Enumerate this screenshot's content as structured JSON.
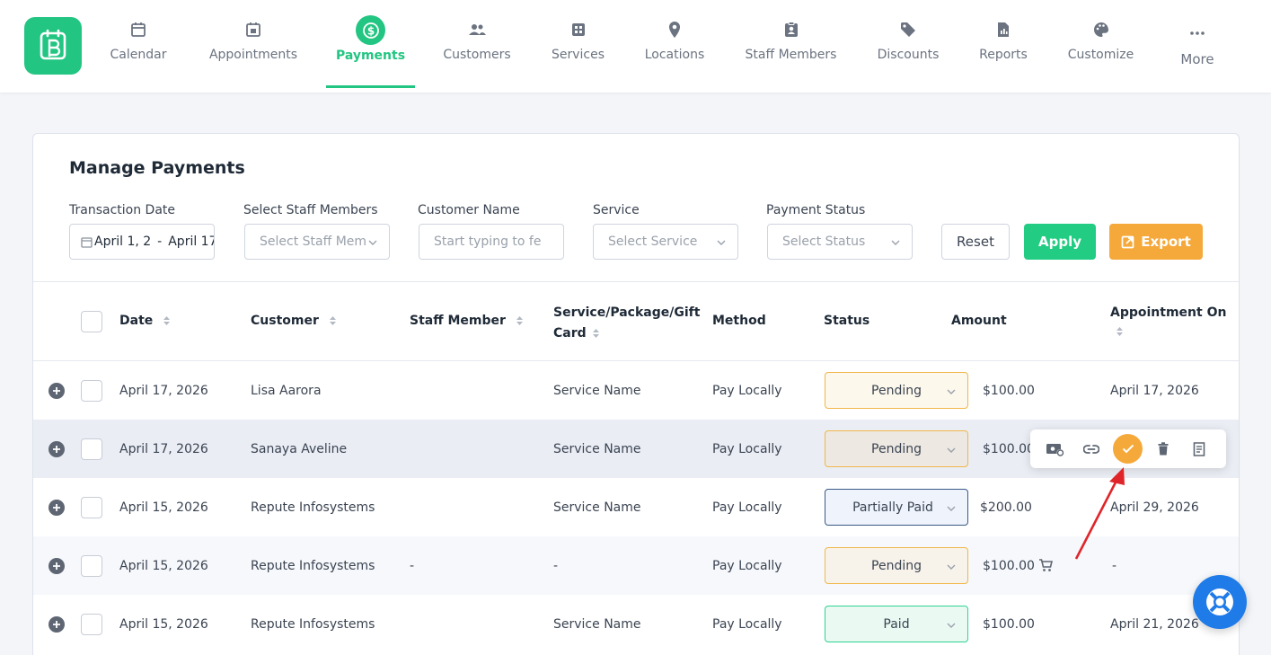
{
  "nav": {
    "items": [
      {
        "label": "Calendar",
        "icon": "calendar-icon"
      },
      {
        "label": "Appointments",
        "icon": "calendar-check-icon"
      },
      {
        "label": "Payments",
        "icon": "dollar-circle-icon",
        "active": true
      },
      {
        "label": "Customers",
        "icon": "users-icon"
      },
      {
        "label": "Services",
        "icon": "grid-list-icon"
      },
      {
        "label": "Locations",
        "icon": "map-pin-icon"
      },
      {
        "label": "Staff Members",
        "icon": "id-badge-icon"
      },
      {
        "label": "Discounts",
        "icon": "tag-icon"
      },
      {
        "label": "Reports",
        "icon": "report-icon"
      },
      {
        "label": "Customize",
        "icon": "palette-icon"
      },
      {
        "label": "More",
        "icon": "more-dots-icon"
      }
    ]
  },
  "page": {
    "title": "Manage Payments"
  },
  "filters": {
    "transaction_date": {
      "label": "Transaction Date",
      "value_start": "April 1, 2",
      "separator": "-",
      "value_end": "April 17,"
    },
    "staff": {
      "label": "Select Staff Members",
      "placeholder": "Select Staff Mem"
    },
    "customer": {
      "label": "Customer Name",
      "placeholder": "Start typing to fe"
    },
    "service": {
      "label": "Service",
      "placeholder": "Select Service"
    },
    "status": {
      "label": "Payment Status",
      "placeholder": "Select Status"
    },
    "reset_label": "Reset",
    "apply_label": "Apply",
    "export_label": "Export"
  },
  "table": {
    "headers": {
      "date": "Date",
      "customer": "Customer",
      "staff": "Staff Member",
      "service_line1": "Service/Package/Gift",
      "service_line2": "Card",
      "method": "Method",
      "status": "Status",
      "amount": "Amount",
      "appointment": "Appointment On"
    },
    "rows": [
      {
        "date": "April 17, 2026",
        "customer": "Lisa Aarora",
        "staff": "",
        "service": "Service Name",
        "method": "Pay Locally",
        "status": "Pending",
        "amount": "$100.00",
        "appointment": "April 17, 2026"
      },
      {
        "date": "April 17, 2026",
        "customer": "Sanaya Aveline",
        "staff": "",
        "service": "Service Name",
        "method": "Pay Locally",
        "status": "Pending",
        "amount": "$100.00",
        "appointment": ""
      },
      {
        "date": "April 15, 2026",
        "customer": "Repute Infosystems",
        "staff": "",
        "service": "Service Name",
        "method": "Pay Locally",
        "status": "Partially Paid",
        "amount": "$200.00",
        "appointment": "April 29, 2026"
      },
      {
        "date": "April 15, 2026",
        "customer": "Repute Infosystems",
        "staff": "-",
        "service": "-",
        "method": "Pay Locally",
        "status": "Pending",
        "amount": "$100.00",
        "appointment": "-"
      },
      {
        "date": "April 15, 2026",
        "customer": "Repute Infosystems",
        "staff": "",
        "service": "Service Name",
        "method": "Pay Locally",
        "status": "Paid",
        "amount": "$100.00",
        "appointment": "April 21, 2026"
      }
    ]
  },
  "colors": {
    "brand": "#22c581",
    "apply": "#22cc82",
    "export": "#f5a93b",
    "help": "#1f7be8"
  }
}
